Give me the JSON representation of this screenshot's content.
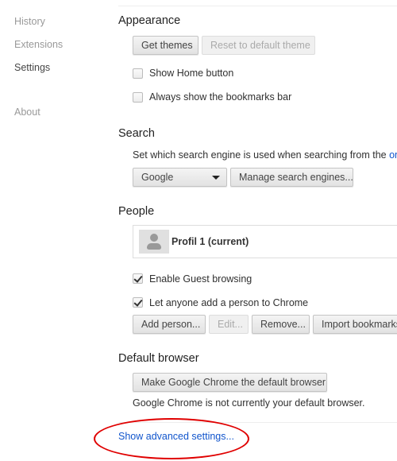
{
  "sidebar": {
    "items": [
      {
        "label": "History"
      },
      {
        "label": "Extensions"
      },
      {
        "label": "Settings",
        "selected": true
      },
      {
        "label": "About"
      }
    ]
  },
  "appearance": {
    "title": "Appearance",
    "get_themes": "Get themes",
    "reset_theme": "Reset to default theme",
    "show_home": {
      "label": "Show Home button",
      "checked": false
    },
    "bookmarks_bar": {
      "label": "Always show the bookmarks bar",
      "checked": false
    }
  },
  "search": {
    "title": "Search",
    "description": "Set which search engine is used when searching from the ",
    "link": "omni",
    "engine": "Google",
    "manage": "Manage search engines..."
  },
  "people": {
    "title": "People",
    "profile": "Profil 1 (current)",
    "guest": {
      "label": "Enable Guest browsing",
      "checked": true
    },
    "add_anyone": {
      "label": "Let anyone add a person to Chrome",
      "checked": true
    },
    "add_person": "Add person...",
    "edit": "Edit...",
    "remove": "Remove...",
    "import": "Import bookmarks"
  },
  "default_browser": {
    "title": "Default browser",
    "make_default": "Make Google Chrome the default browser",
    "status": "Google Chrome is not currently your default browser."
  },
  "advanced_link": "Show advanced settings...",
  "colors": {
    "link": "#1155cc",
    "annotation": "#e00000"
  }
}
